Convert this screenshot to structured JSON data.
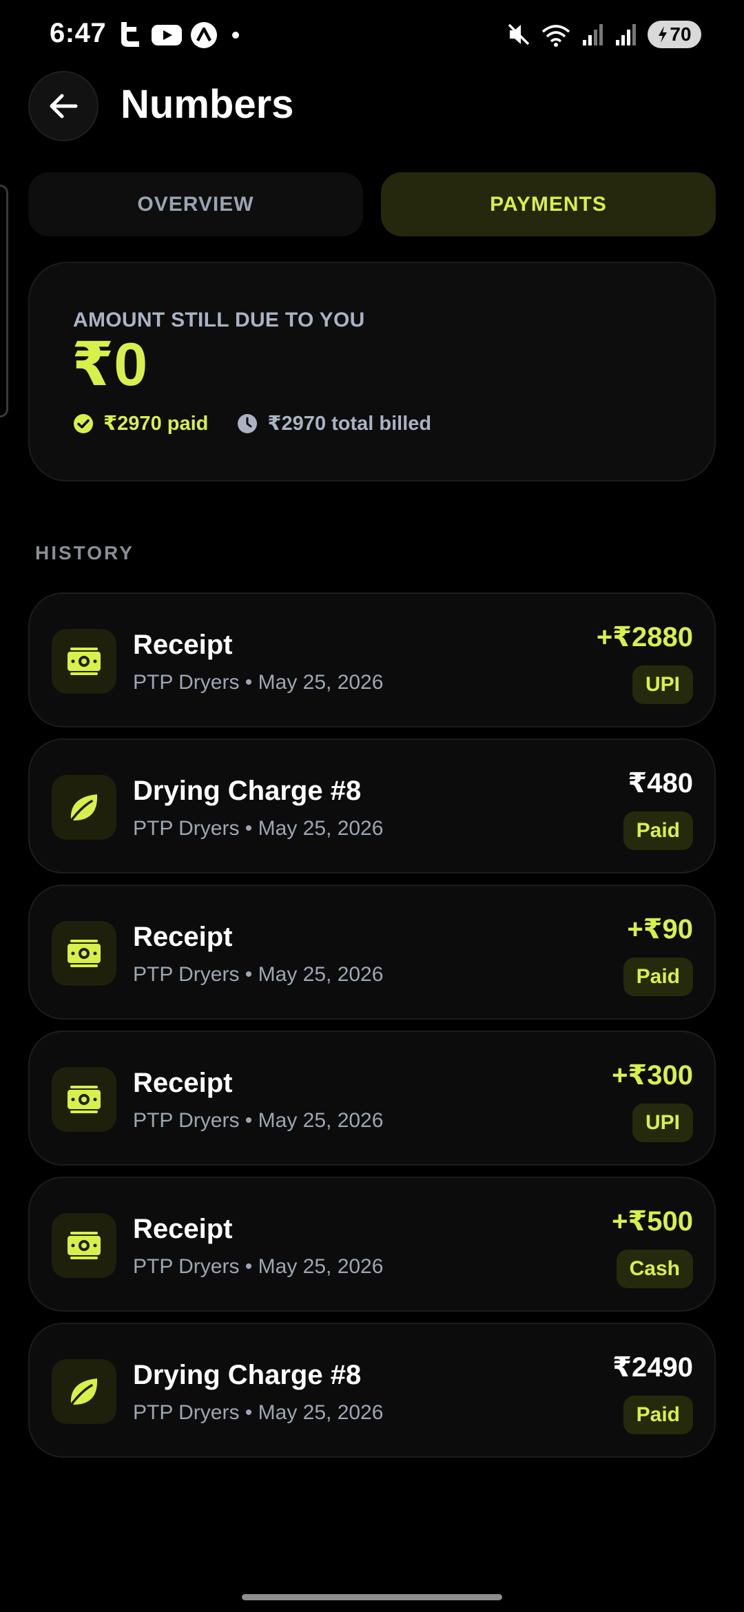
{
  "status_bar": {
    "time": "6:47",
    "battery": "70",
    "icons": [
      "t-app-icon",
      "youtube-icon",
      "app-icon",
      "dot-icon",
      "mute-icon",
      "wifi-icon",
      "signal-icon",
      "signal-icon",
      "battery-icon"
    ]
  },
  "header": {
    "title": "Numbers",
    "back_icon": "arrow-left-icon"
  },
  "tabs": [
    {
      "label": "OVERVIEW",
      "active": false
    },
    {
      "label": "PAYMENTS",
      "active": true
    }
  ],
  "summary": {
    "label": "AMOUNT STILL DUE TO YOU",
    "amount": "₹0",
    "paid": "₹2970 paid",
    "billed": "₹2970 total billed"
  },
  "history": {
    "heading": "HISTORY",
    "items": [
      {
        "icon": "money-icon",
        "title": "Receipt",
        "subtitle": "PTP Dryers • May 25, 2026",
        "amount": "+₹2880",
        "badge": "UPI",
        "type": "credit"
      },
      {
        "icon": "leaf-icon",
        "title": "Drying Charge #8",
        "subtitle": "PTP Dryers • May 25, 2026",
        "amount": "₹480",
        "badge": "Paid",
        "type": "debit"
      },
      {
        "icon": "money-icon",
        "title": "Receipt",
        "subtitle": "PTP Dryers • May 25, 2026",
        "amount": "+₹90",
        "badge": "Paid",
        "type": "credit"
      },
      {
        "icon": "money-icon",
        "title": "Receipt",
        "subtitle": "PTP Dryers • May 25, 2026",
        "amount": "+₹300",
        "badge": "UPI",
        "type": "credit"
      },
      {
        "icon": "money-icon",
        "title": "Receipt",
        "subtitle": "PTP Dryers • May 25, 2026",
        "amount": "+₹500",
        "badge": "Cash",
        "type": "credit"
      },
      {
        "icon": "leaf-icon",
        "title": "Drying Charge #8",
        "subtitle": "PTP Dryers • May 25, 2026",
        "amount": "₹2490",
        "badge": "Paid",
        "type": "debit"
      }
    ]
  },
  "colors": {
    "accent": "#d8f04a",
    "background": "#000000",
    "card": "#0c0c0c",
    "muted_text": "#9ea6b4"
  }
}
